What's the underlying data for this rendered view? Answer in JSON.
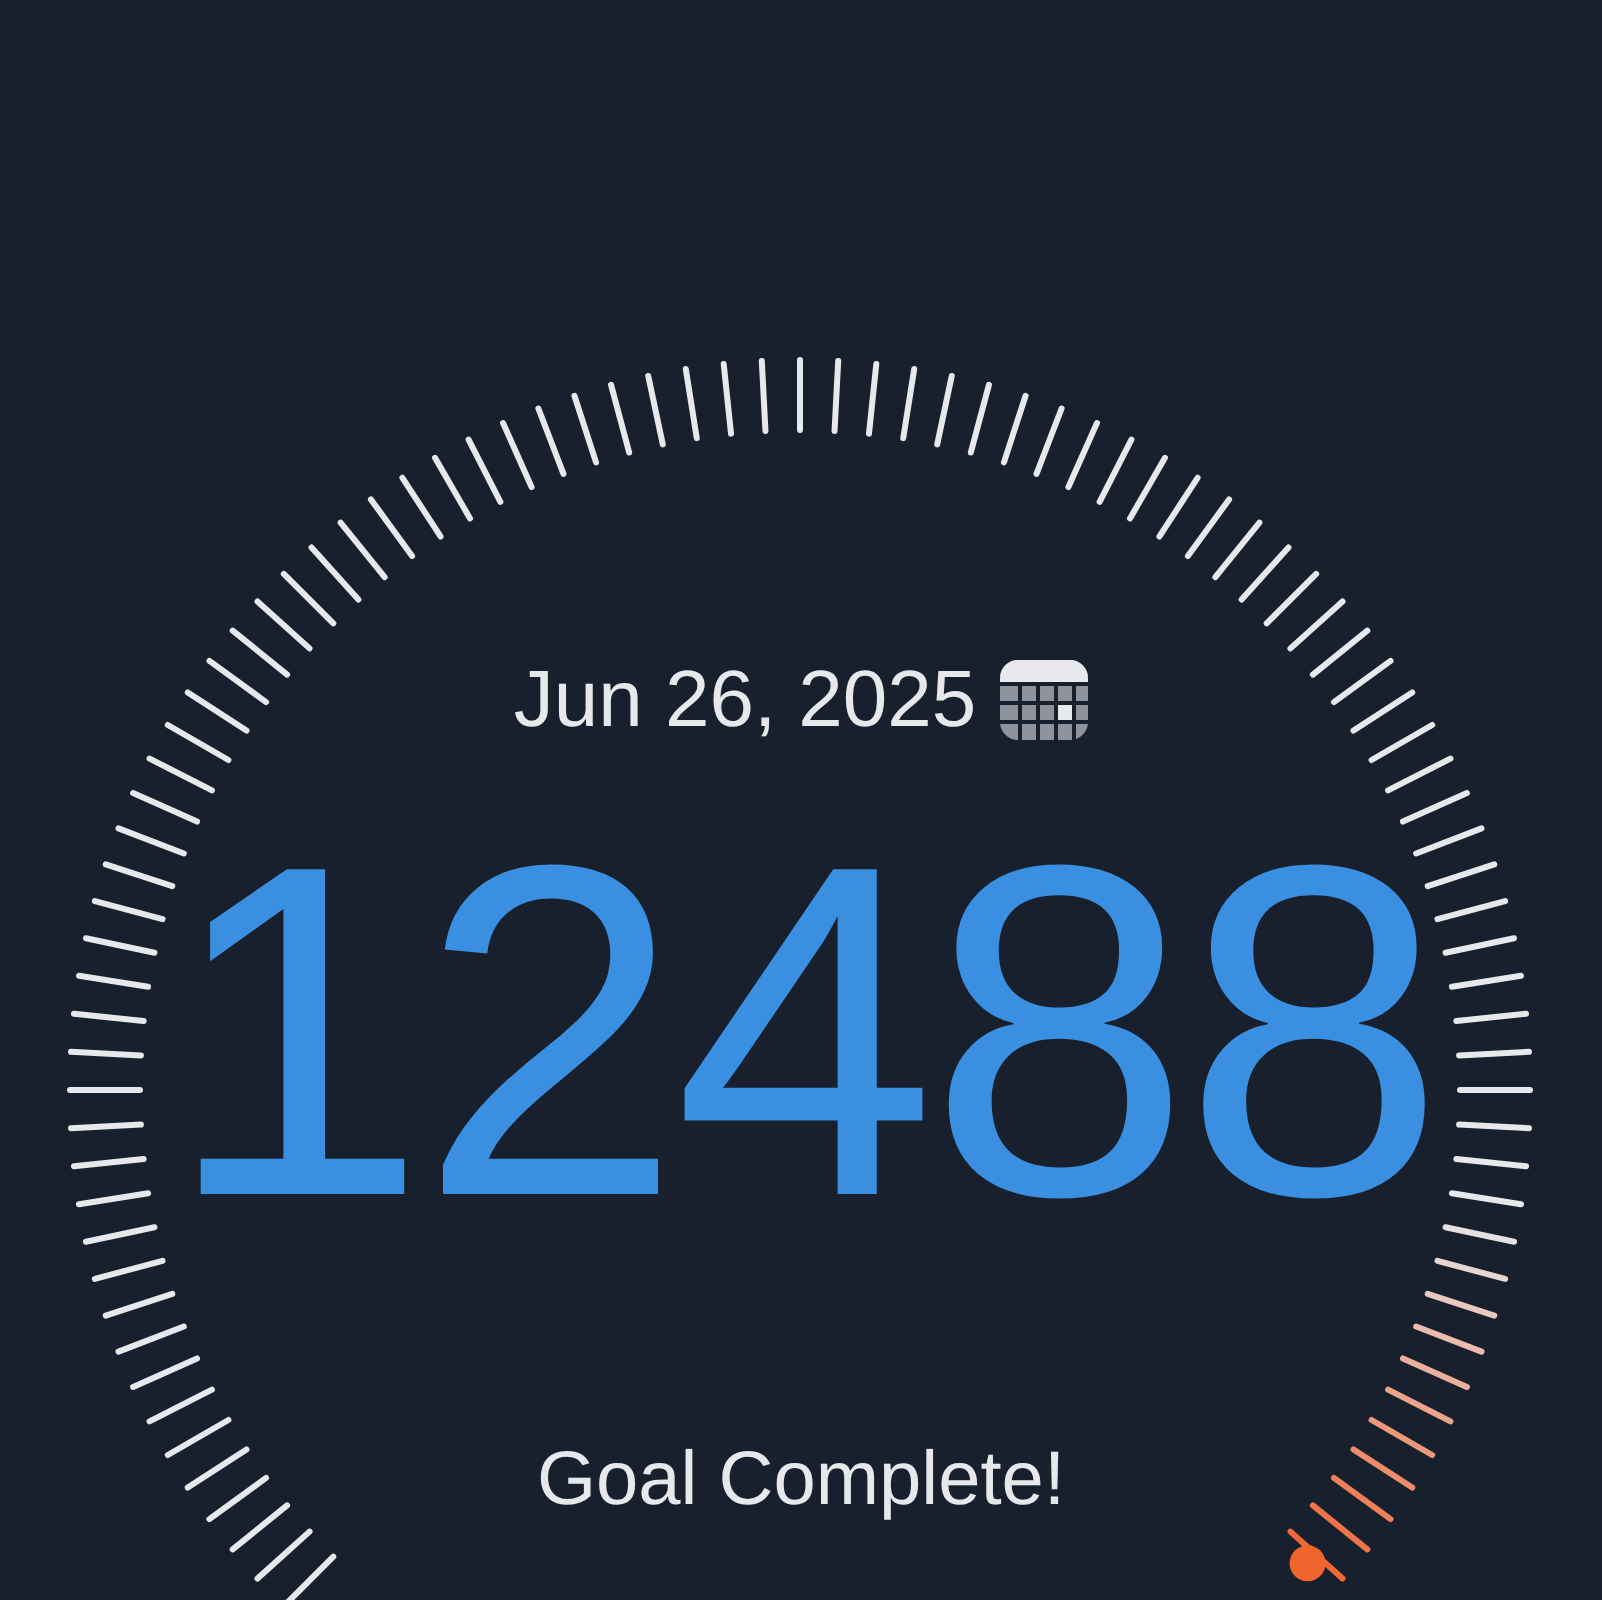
{
  "date": "Jun 26, 2025",
  "steps": "12488",
  "status": "Goal Complete!"
}
